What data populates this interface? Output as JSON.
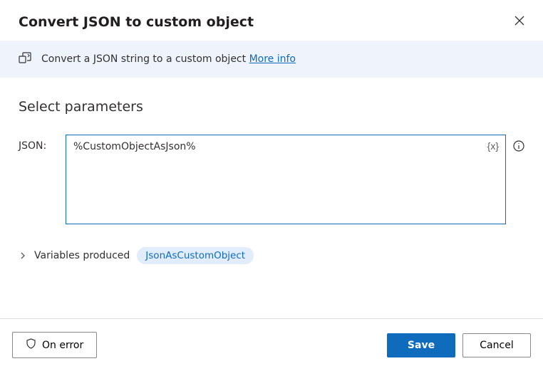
{
  "dialog": {
    "title": "Convert JSON to custom object"
  },
  "info": {
    "description": "Convert a JSON string to a custom object ",
    "more_info": "More info"
  },
  "params": {
    "section_title": "Select parameters",
    "json_label": "JSON:",
    "json_value": "%CustomObjectAsJson%",
    "var_insert_label": "{x}"
  },
  "variables": {
    "produced_label": "Variables produced",
    "chip": "JsonAsCustomObject"
  },
  "footer": {
    "on_error": "On error",
    "save": "Save",
    "cancel": "Cancel"
  }
}
